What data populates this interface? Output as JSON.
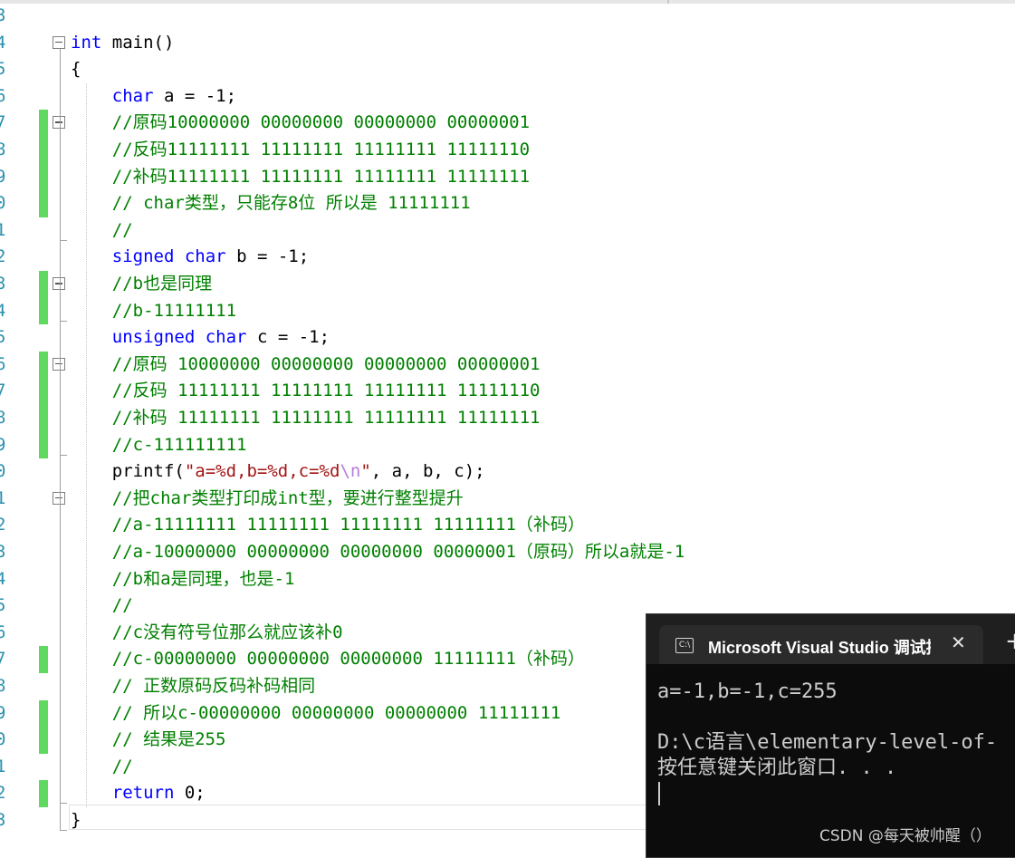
{
  "editor": {
    "line_numbers": [
      "3",
      "4",
      "5",
      "6",
      "7",
      "8",
      "9",
      "0",
      "1",
      "2",
      "3",
      "4",
      "5",
      "6",
      "7",
      "8",
      "9",
      "0",
      "1",
      "2",
      "3",
      "4",
      "5",
      "6",
      "7",
      "8",
      "9",
      "0",
      "1",
      "2",
      "3"
    ],
    "lines": [
      {
        "tokens": []
      },
      {
        "tokens": [
          {
            "t": "int",
            "c": "kw"
          },
          {
            "t": " main()",
            "c": "id"
          }
        ]
      },
      {
        "tokens": [
          {
            "t": "{",
            "c": "id"
          }
        ]
      },
      {
        "tokens": [
          {
            "t": "    "
          },
          {
            "t": "char",
            "c": "kw"
          },
          {
            "t": " a = -1;",
            "c": "id"
          }
        ]
      },
      {
        "tokens": [
          {
            "t": "    "
          },
          {
            "t": "//原码10000000 00000000 00000000 00000001",
            "c": "cm"
          }
        ]
      },
      {
        "tokens": [
          {
            "t": "    "
          },
          {
            "t": "//反码11111111 11111111 11111111 11111110",
            "c": "cm"
          }
        ]
      },
      {
        "tokens": [
          {
            "t": "    "
          },
          {
            "t": "//补码11111111 11111111 11111111 11111111",
            "c": "cm"
          }
        ]
      },
      {
        "tokens": [
          {
            "t": "    "
          },
          {
            "t": "// char类型，只能存8位 所以是 11111111",
            "c": "cm"
          }
        ]
      },
      {
        "tokens": [
          {
            "t": "    "
          },
          {
            "t": "//",
            "c": "cm"
          }
        ]
      },
      {
        "tokens": [
          {
            "t": "    "
          },
          {
            "t": "signed",
            "c": "kw"
          },
          {
            "t": " "
          },
          {
            "t": "char",
            "c": "kw"
          },
          {
            "t": " b = -1;",
            "c": "id"
          }
        ]
      },
      {
        "tokens": [
          {
            "t": "    "
          },
          {
            "t": "//b也是同理",
            "c": "cm"
          }
        ]
      },
      {
        "tokens": [
          {
            "t": "    "
          },
          {
            "t": "//b-11111111",
            "c": "cm"
          }
        ]
      },
      {
        "tokens": [
          {
            "t": "    "
          },
          {
            "t": "unsigned",
            "c": "kw"
          },
          {
            "t": " "
          },
          {
            "t": "char",
            "c": "kw"
          },
          {
            "t": " c = -1;",
            "c": "id"
          }
        ]
      },
      {
        "tokens": [
          {
            "t": "    "
          },
          {
            "t": "//原码 10000000 00000000 00000000 00000001",
            "c": "cm"
          }
        ]
      },
      {
        "tokens": [
          {
            "t": "    "
          },
          {
            "t": "//反码 11111111 11111111 11111111 11111110",
            "c": "cm"
          }
        ]
      },
      {
        "tokens": [
          {
            "t": "    "
          },
          {
            "t": "//补码 11111111 11111111 11111111 11111111",
            "c": "cm"
          }
        ]
      },
      {
        "tokens": [
          {
            "t": "    "
          },
          {
            "t": "//c-111111111",
            "c": "cm"
          }
        ]
      },
      {
        "tokens": [
          {
            "t": "    "
          },
          {
            "t": "printf(",
            "c": "id"
          },
          {
            "t": "\"a=%d,b=%d,c=%d",
            "c": "str"
          },
          {
            "t": "\\n",
            "c": "esc"
          },
          {
            "t": "\"",
            "c": "str"
          },
          {
            "t": ", a, b, c);",
            "c": "id"
          }
        ]
      },
      {
        "tokens": [
          {
            "t": "    "
          },
          {
            "t": "//把char类型打印成int型，要进行整型提升",
            "c": "cm"
          }
        ]
      },
      {
        "tokens": [
          {
            "t": "    "
          },
          {
            "t": "//a-11111111 11111111 11111111 11111111（补码）",
            "c": "cm"
          }
        ]
      },
      {
        "tokens": [
          {
            "t": "    "
          },
          {
            "t": "//a-10000000 00000000 00000000 00000001（原码）所以a就是-1",
            "c": "cm"
          }
        ]
      },
      {
        "tokens": [
          {
            "t": "    "
          },
          {
            "t": "//b和a是同理，也是-1",
            "c": "cm"
          }
        ]
      },
      {
        "tokens": [
          {
            "t": "    "
          },
          {
            "t": "//",
            "c": "cm"
          }
        ]
      },
      {
        "tokens": [
          {
            "t": "    "
          },
          {
            "t": "//c没有符号位那么就应该补0",
            "c": "cm"
          }
        ]
      },
      {
        "tokens": [
          {
            "t": "    "
          },
          {
            "t": "//c-00000000 00000000 00000000 11111111（补码）",
            "c": "cm"
          }
        ]
      },
      {
        "tokens": [
          {
            "t": "    "
          },
          {
            "t": "// 正数原码反码补码相同",
            "c": "cm"
          }
        ]
      },
      {
        "tokens": [
          {
            "t": "    "
          },
          {
            "t": "// 所以c-00000000 00000000 00000000 11111111",
            "c": "cm"
          }
        ]
      },
      {
        "tokens": [
          {
            "t": "    "
          },
          {
            "t": "// 结果是255",
            "c": "cm"
          }
        ]
      },
      {
        "tokens": [
          {
            "t": "    "
          },
          {
            "t": "//",
            "c": "cm"
          }
        ]
      },
      {
        "tokens": [
          {
            "t": "    "
          },
          {
            "t": "return",
            "c": "kw"
          },
          {
            "t": " 0;",
            "c": "id"
          }
        ]
      },
      {
        "tokens": [
          {
            "t": "}",
            "c": "id"
          }
        ]
      }
    ]
  },
  "console": {
    "tab_title": "Microsoft Visual Studio 调试控制台",
    "tab_icon_glyph": "C:\\",
    "close_glyph": "✕",
    "new_tab_glyph": "+",
    "output_line1": "a=-1,b=-1,c=255",
    "output_line2": "D:\\c语言\\elementary-level-of-",
    "output_line3": "按任意键关闭此窗口. . ."
  },
  "watermark": "CSDN @每天被帅醒（）",
  "colors": {
    "keyword": "#0000ff",
    "comment": "#008000",
    "string": "#a31515",
    "escape": "#b77bd8",
    "line_number": "#2b91af",
    "change_bar": "#5fd95f",
    "console_bg": "#0c0c0c"
  }
}
